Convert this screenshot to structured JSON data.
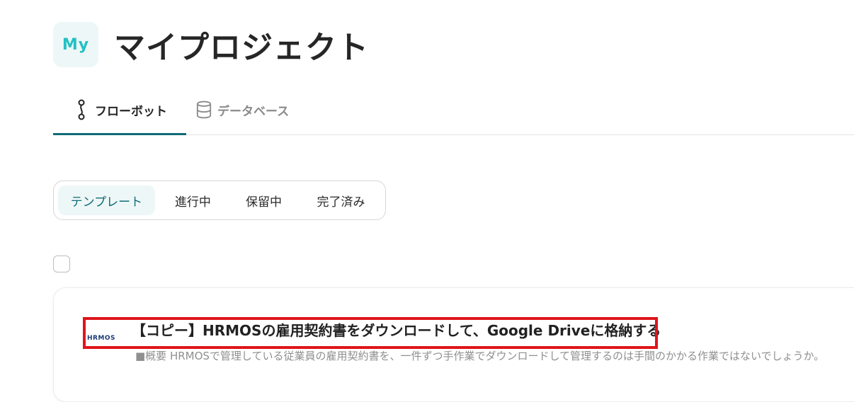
{
  "header": {
    "avatar_text": "My",
    "title": "マイプロジェクト"
  },
  "tabs": [
    {
      "label": "フローボット",
      "icon": "flowbot-icon",
      "active": true
    },
    {
      "label": "データベース",
      "icon": "database-icon",
      "active": false
    }
  ],
  "filters": [
    {
      "label": "テンプレート",
      "active": true
    },
    {
      "label": "進行中",
      "active": false
    },
    {
      "label": "保留中",
      "active": false
    },
    {
      "label": "完了済み",
      "active": false
    }
  ],
  "flow": {
    "logo_text": "HRMOS",
    "title": "【コピー】HRMOSの雇用契約書をダウンロードして、Google Driveに格納する",
    "description": "■概要 HRMOSで管理している従業員の雇用契約書を、一件ずつ手作業でダウンロードして管理するのは手間のかかる作業ではないでしょうか。"
  },
  "colors": {
    "accent": "#0f6b78",
    "avatar_text": "#23c0c4",
    "highlight": "#e0141b"
  }
}
